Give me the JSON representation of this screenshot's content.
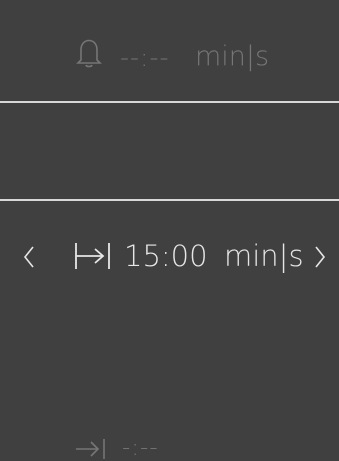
{
  "timer": {
    "icon": "bell-icon",
    "value": "--:--",
    "unit": "min|s"
  },
  "duration": {
    "prev_icon": "chevron-left-icon",
    "icon": "duration-start-end-icon",
    "value": "15:00",
    "unit": "min|s",
    "next_icon": "chevron-right-icon"
  },
  "end_time": {
    "icon": "end-time-icon",
    "value": "-:--"
  },
  "colors": {
    "background": "#404040",
    "active_text": "#e6e6e6",
    "inactive_text": "#767676",
    "divider": "#d8d8d8"
  }
}
